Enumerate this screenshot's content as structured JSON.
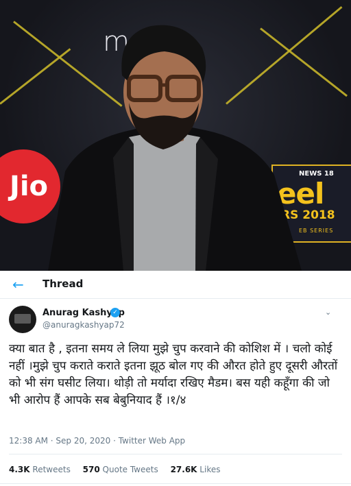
{
  "photo": {
    "backdrop_text": "me",
    "brand_left_text": "Jio",
    "event_logo": {
      "network": "NEWS 18",
      "word": "eel",
      "year": "RS 2018",
      "series": "EB SERIES"
    }
  },
  "thread": {
    "back_icon": "arrow-left-icon",
    "title": "Thread"
  },
  "tweet": {
    "author_name": "Anurag Kashyap",
    "handle": "@anuragkashyap72",
    "verified_icon": "verified-badge-icon",
    "text": "क्या बात है , इतना समय ले लिया मुझे चुप करवाने की कोशिश में । चलो कोई नहीं ।मुझे चुप कराते कराते इतना झूठ बोल गए की औरत होते हुए दूसरी औरतों को भी संग घसीट लिया। थोड़ी तो मर्यादा रखिए मैडम। बस यही कहूँगा की जो भी आरोप हैं आपके सब बेबुनियाद हैं ।१/४",
    "timestamp": "12:38 AM · Sep 20, 2020 · Twitter Web App"
  },
  "stats": {
    "retweets_count": "4.3K",
    "retweets_label": "Retweets",
    "quotes_count": "570",
    "quotes_label": "Quote Tweets",
    "likes_count": "27.6K",
    "likes_label": "Likes"
  },
  "colors": {
    "accent": "#1da1f2",
    "text_primary": "#14171a",
    "text_secondary": "#657786"
  }
}
